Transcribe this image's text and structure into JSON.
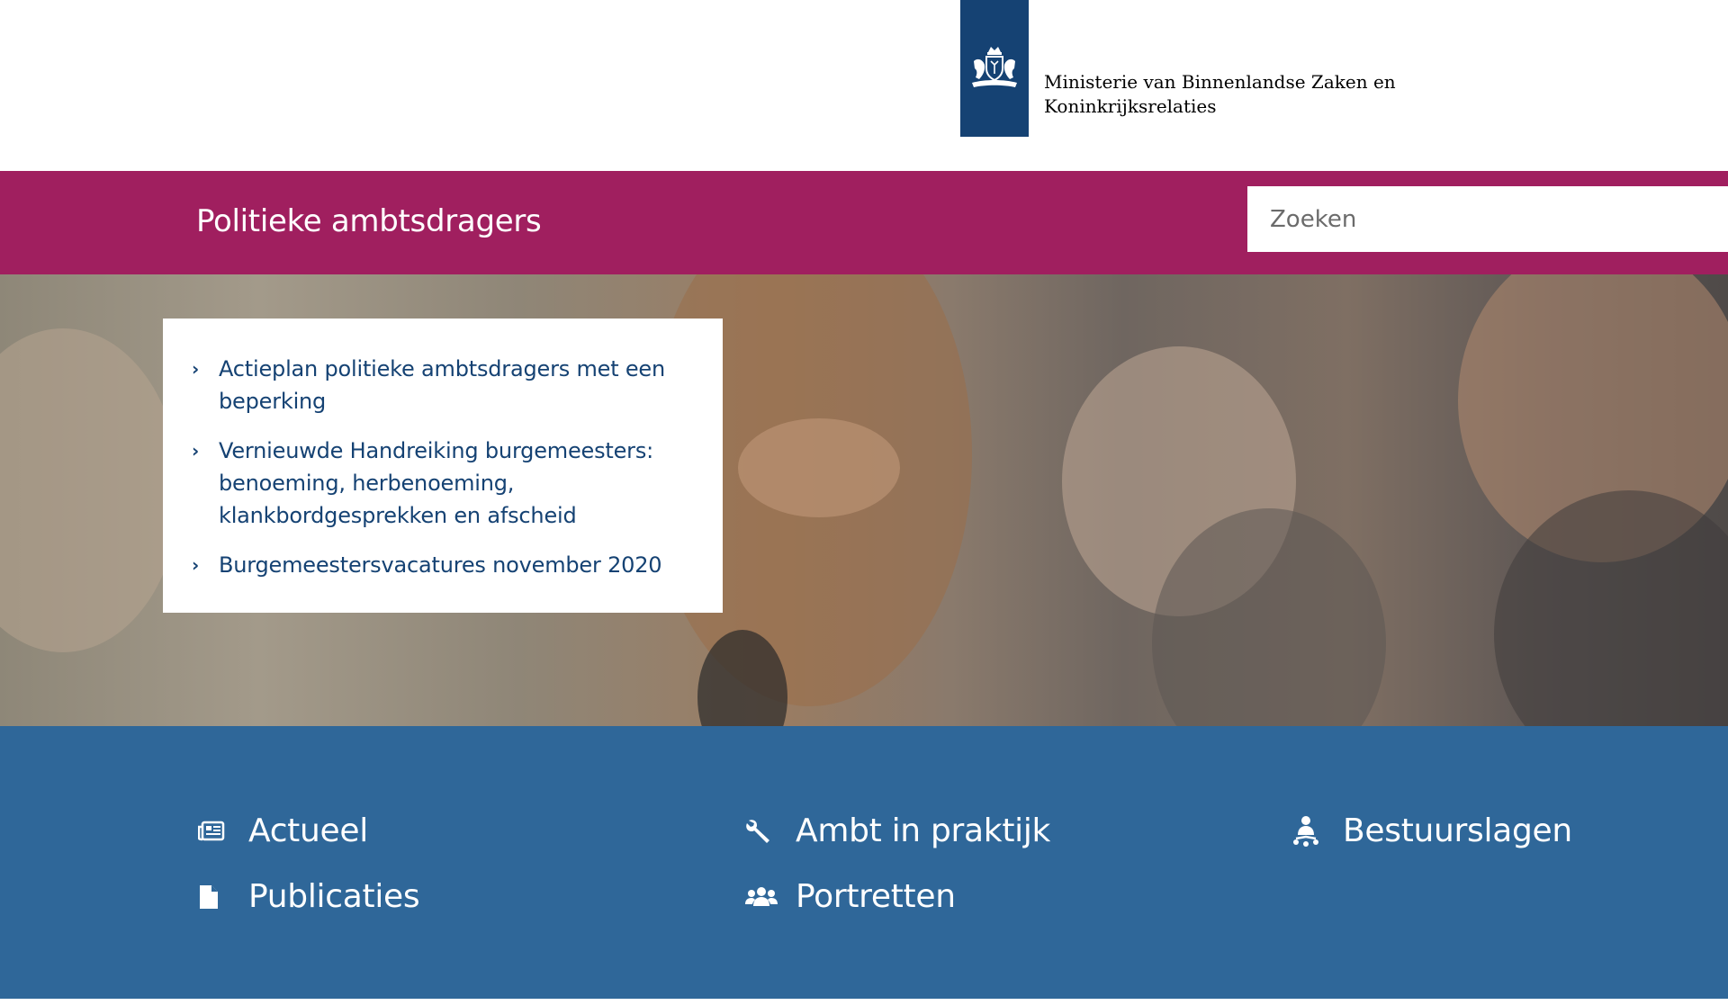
{
  "header": {
    "ministry_name_line1": "Ministerie van Binnenlandse Zaken en",
    "ministry_name_line2": "Koninkrijksrelaties",
    "logo_icon": "rijksoverheid-coat-of-arms-icon"
  },
  "title_bar": {
    "site_title": "Politieke ambtsdragers",
    "search_placeholder": "Zoeken"
  },
  "hero": {
    "links": [
      {
        "label": "Actieplan politieke ambtsdragers met een beperking",
        "icon": "chevron-right-icon"
      },
      {
        "label": "Vernieuwde Handreiking burgemeesters: benoeming, herbenoeming, klankbordgesprekken en afscheid",
        "icon": "chevron-right-icon"
      },
      {
        "label": "Burgemeestersvacatures november 2020",
        "icon": "chevron-right-icon"
      }
    ]
  },
  "nav": {
    "items": [
      {
        "label": "Actueel",
        "icon": "newspaper-icon"
      },
      {
        "label": "Ambt in praktijk",
        "icon": "wrench-icon"
      },
      {
        "label": "Bestuurslagen",
        "icon": "hierarchy-icon"
      },
      {
        "label": "Publicaties",
        "icon": "document-icon"
      },
      {
        "label": "Portretten",
        "icon": "people-icon"
      }
    ]
  },
  "colors": {
    "title_bar": "#a01f5f",
    "logo_blue": "#154273",
    "nav_blue": "#2f6799",
    "link_blue": "#154273"
  }
}
